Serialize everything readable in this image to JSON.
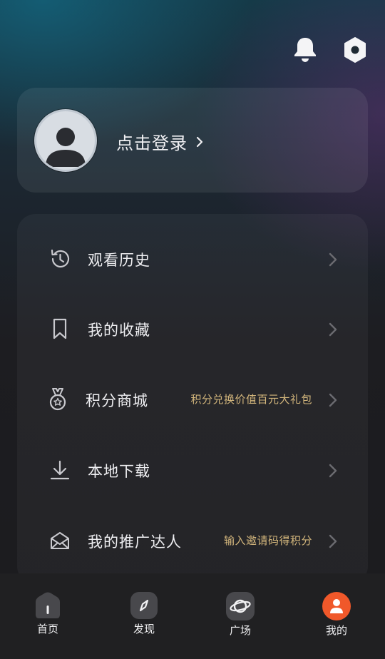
{
  "header": {
    "icons": [
      "bell-icon",
      "settings-hexagon-icon"
    ]
  },
  "profile": {
    "login_label": "点击登录",
    "avatar_icon": "default-avatar-icon"
  },
  "menu": {
    "items": [
      {
        "label": "观看历史",
        "hint": "",
        "icon": "history-icon"
      },
      {
        "label": "我的收藏",
        "hint": "",
        "icon": "bookmark-icon"
      },
      {
        "label": "积分商城",
        "hint": "积分兑换价值百元大礼包",
        "icon": "medal-icon"
      },
      {
        "label": "本地下载",
        "hint": "",
        "icon": "download-icon"
      },
      {
        "label": "我的推广达人",
        "hint": "输入邀请码得积分",
        "icon": "envelope-open-icon"
      }
    ],
    "hint_color": "#d3b67c"
  },
  "tabbar": {
    "tabs": [
      {
        "label": "首页",
        "icon": "home-icon",
        "active": false
      },
      {
        "label": "发现",
        "icon": "compass-icon",
        "active": false
      },
      {
        "label": "广场",
        "icon": "planet-icon",
        "active": false
      },
      {
        "label": "我的",
        "icon": "user-icon",
        "active": true
      }
    ],
    "active_color": "#f0582a"
  }
}
